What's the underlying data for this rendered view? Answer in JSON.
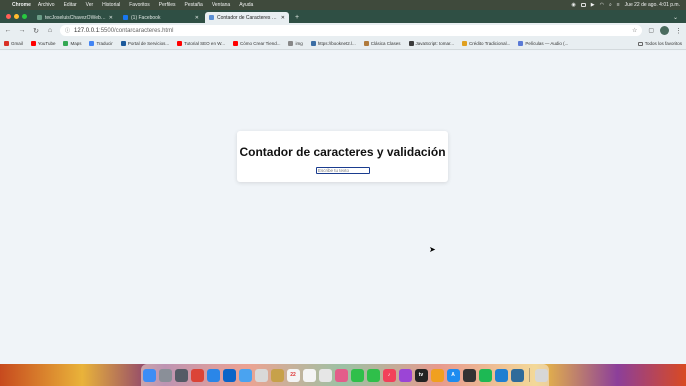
{
  "menubar": {
    "app_name": "Chrome",
    "items": [
      "Archivo",
      "Editar",
      "Ver",
      "Historial",
      "Favoritos",
      "Perfiles",
      "Pestaña",
      "Ventana",
      "Ayuda"
    ],
    "datetime": "Jue 22 de ago. 4:01 p.m."
  },
  "tabs": [
    {
      "title": "tecJoseluisChavezOWeb — D...",
      "active": false,
      "favicon_color": "#6a9c86"
    },
    {
      "title": "(1) Facebook",
      "active": false,
      "favicon_color": "#1877f2"
    },
    {
      "title": "Contador de Caracteres y Va...",
      "active": true,
      "favicon_color": "#5b8fd4"
    }
  ],
  "toolbar": {
    "url_host": "127.0.0.1",
    "url_rest": ":5500/contarcaracteres.html"
  },
  "bookmarks": {
    "items": [
      {
        "label": "Gmail",
        "color": "#d93025"
      },
      {
        "label": "YouTube",
        "color": "#ff0000"
      },
      {
        "label": "Maps",
        "color": "#34a853"
      },
      {
        "label": "Traducir",
        "color": "#4285f4"
      },
      {
        "label": "Portal de Servicios...",
        "color": "#1c5a9c"
      },
      {
        "label": "Tutorial SEO en W...",
        "color": "#ff0000"
      },
      {
        "label": "Cómo Crear Tiend...",
        "color": "#ff0000"
      },
      {
        "label": "img",
        "color": "#888888"
      },
      {
        "label": "https://booknet2.l...",
        "color": "#3b6ea5"
      },
      {
        "label": "Clásica Clases",
        "color": "#b07a3c"
      },
      {
        "label": "JavaScript: tomar...",
        "color": "#3c3c3c"
      },
      {
        "label": "Crédito Tradicional...",
        "color": "#e0a020"
      },
      {
        "label": "Películas — Audio (...",
        "color": "#5a7ad6"
      }
    ],
    "all_label": "Todos los favoritos"
  },
  "page": {
    "heading": "Contador de caracteres y validación",
    "input_placeholder": "Escribe tu texto",
    "input_value": ""
  },
  "dock": {
    "apps": [
      {
        "name": "finder-icon",
        "color": "#3d8df5"
      },
      {
        "name": "launchpad-icon",
        "color": "#8a8f98"
      },
      {
        "name": "app-grid-icon",
        "color": "#555b66"
      },
      {
        "name": "chrome-icon",
        "color": "#db4437"
      },
      {
        "name": "safari-icon",
        "color": "#2a86e8"
      },
      {
        "name": "outlook-icon",
        "color": "#0a64c8"
      },
      {
        "name": "mail-icon",
        "color": "#4aa3f0"
      },
      {
        "name": "notes-folder-icon",
        "color": "#d9d9d9"
      },
      {
        "name": "stickies-icon",
        "color": "#c7a14a"
      },
      {
        "name": "calendar-icon",
        "color": "#f4f4f4"
      },
      {
        "name": "reminders-icon",
        "color": "#f4f4f4"
      },
      {
        "name": "freeform-icon",
        "color": "#e6e6e6"
      },
      {
        "name": "photos-icon",
        "color": "#e35d8a"
      },
      {
        "name": "facetime-icon",
        "color": "#2fbf4a"
      },
      {
        "name": "messages-icon",
        "color": "#2fbf4a"
      },
      {
        "name": "music-icon",
        "color": "#f2405a"
      },
      {
        "name": "podcasts-icon",
        "color": "#9b45d6"
      },
      {
        "name": "apple-tv-icon",
        "color": "#222222"
      },
      {
        "name": "keynote-icon",
        "color": "#f0a020"
      },
      {
        "name": "app-store-icon",
        "color": "#1e8cf0"
      },
      {
        "name": "calculator-icon",
        "color": "#333333"
      },
      {
        "name": "spotify-icon",
        "color": "#1db954"
      },
      {
        "name": "vscode-icon",
        "color": "#1f7fd1"
      },
      {
        "name": "system-monitor-icon",
        "color": "#2f6b9a"
      },
      {
        "name": "trash-icon",
        "color": "#d7d7d7"
      }
    ]
  }
}
